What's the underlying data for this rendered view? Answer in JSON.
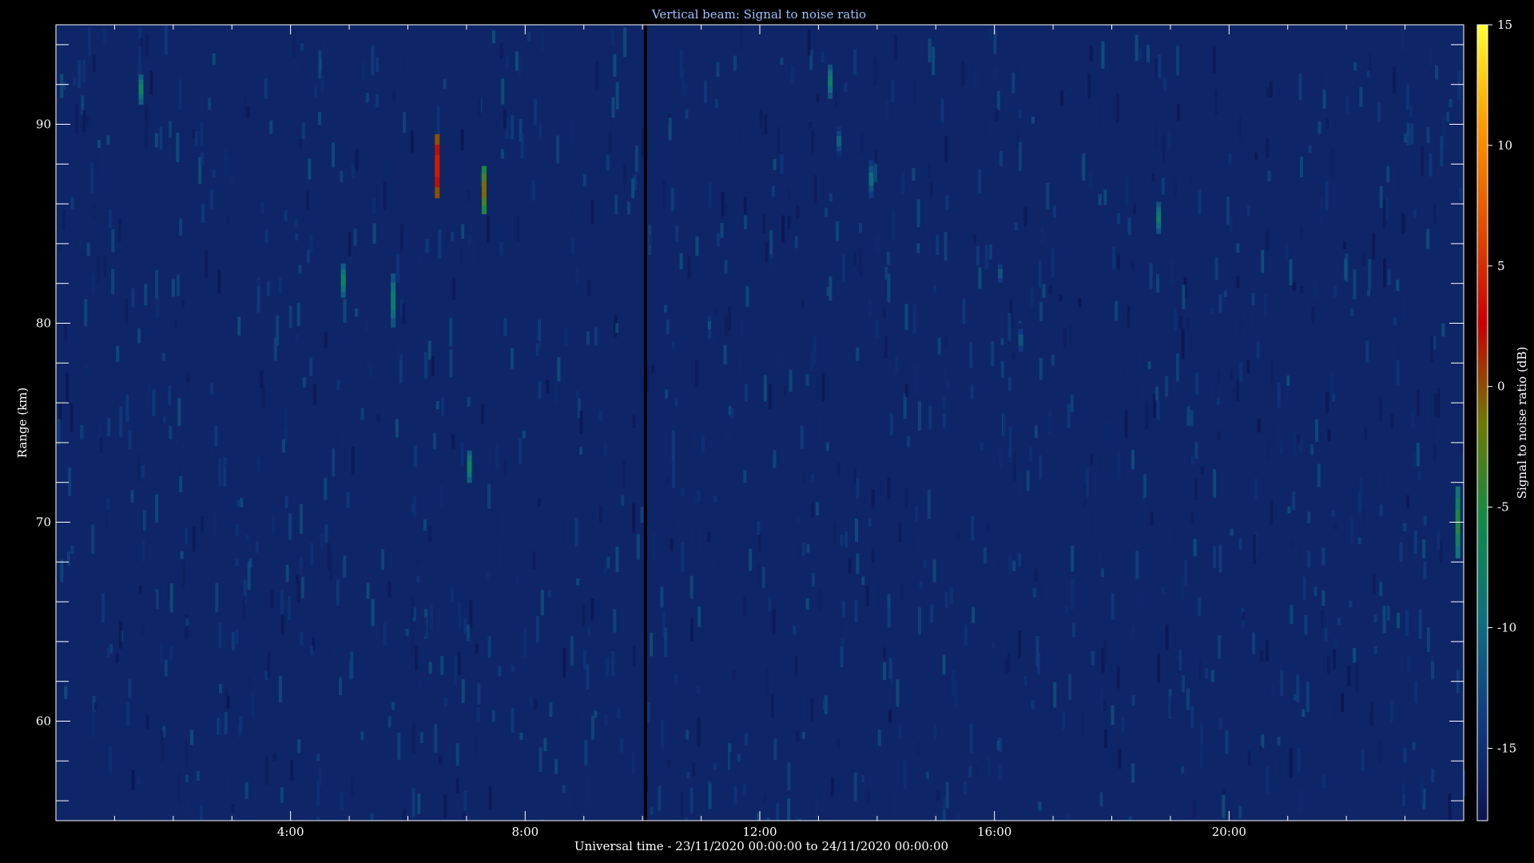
{
  "chart_data": {
    "type": "heatmap",
    "title": "Vertical beam: Signal to noise ratio",
    "xlabel": "Universal time - 23/11/2020 00:00:00 to 24/11/2020 00:00:00",
    "ylabel": "Range (km)",
    "xlim_hours": [
      0,
      24
    ],
    "ylim_km": [
      55,
      95
    ],
    "x_ticks": [
      {
        "hour": 4,
        "label": "4:00"
      },
      {
        "hour": 8,
        "label": "8:00"
      },
      {
        "hour": 12,
        "label": "12:00"
      },
      {
        "hour": 16,
        "label": "16:00"
      },
      {
        "hour": 20,
        "label": "20:00"
      }
    ],
    "y_ticks": [
      {
        "km": 60,
        "label": "60"
      },
      {
        "km": 70,
        "label": "70"
      },
      {
        "km": 80,
        "label": "80"
      },
      {
        "km": 90,
        "label": "90"
      }
    ],
    "colorbar": {
      "label": "Signal to noise ratio (dB)",
      "range_db": [
        -18,
        15
      ],
      "ticks": [
        {
          "db": 15,
          "label": "15"
        },
        {
          "db": 10,
          "label": "10"
        },
        {
          "db": 5,
          "label": "5"
        },
        {
          "db": 0,
          "label": "0"
        },
        {
          "db": -5,
          "label": "-5"
        },
        {
          "db": -10,
          "label": "-10"
        },
        {
          "db": -15,
          "label": "-15"
        }
      ],
      "colormap": [
        "#0c1450",
        "#103a80",
        "#0f6e80",
        "#0f8a4a",
        "#6e7a00",
        "#c80000",
        "#e05000",
        "#ff9a00",
        "#ffff30"
      ]
    },
    "data_gap_hour": 10.05,
    "background_snr_db": -16,
    "echoes": [
      {
        "hour": 1.45,
        "range_km": [
          91.0,
          92.5
        ],
        "snr_db": -6
      },
      {
        "hour": 4.9,
        "range_km": [
          81.3,
          83.0
        ],
        "snr_db": -6
      },
      {
        "hour": 5.75,
        "range_km": [
          79.8,
          82.5
        ],
        "snr_db": -7
      },
      {
        "hour": 6.5,
        "range_km": [
          86.3,
          89.5
        ],
        "snr_db": 5
      },
      {
        "hour": 7.3,
        "range_km": [
          85.5,
          87.9
        ],
        "snr_db": 0
      },
      {
        "hour": 7.05,
        "range_km": [
          72.0,
          73.6
        ],
        "snr_db": -6
      },
      {
        "hour": 13.2,
        "range_km": [
          91.3,
          93.0
        ],
        "snr_db": -7
      },
      {
        "hour": 13.35,
        "range_km": [
          88.4,
          89.9
        ],
        "snr_db": -10
      },
      {
        "hour": 13.9,
        "range_km": [
          86.3,
          88.2
        ],
        "snr_db": -9
      },
      {
        "hour": 18.8,
        "range_km": [
          84.5,
          86.1
        ],
        "snr_db": -7
      },
      {
        "hour": 16.1,
        "range_km": [
          81.8,
          83.2
        ],
        "snr_db": -11
      },
      {
        "hour": 16.45,
        "range_km": [
          78.3,
          80.0
        ],
        "snr_db": -11
      },
      {
        "hour": 23.9,
        "range_km": [
          68.2,
          71.8
        ],
        "snr_db": -4
      }
    ]
  }
}
